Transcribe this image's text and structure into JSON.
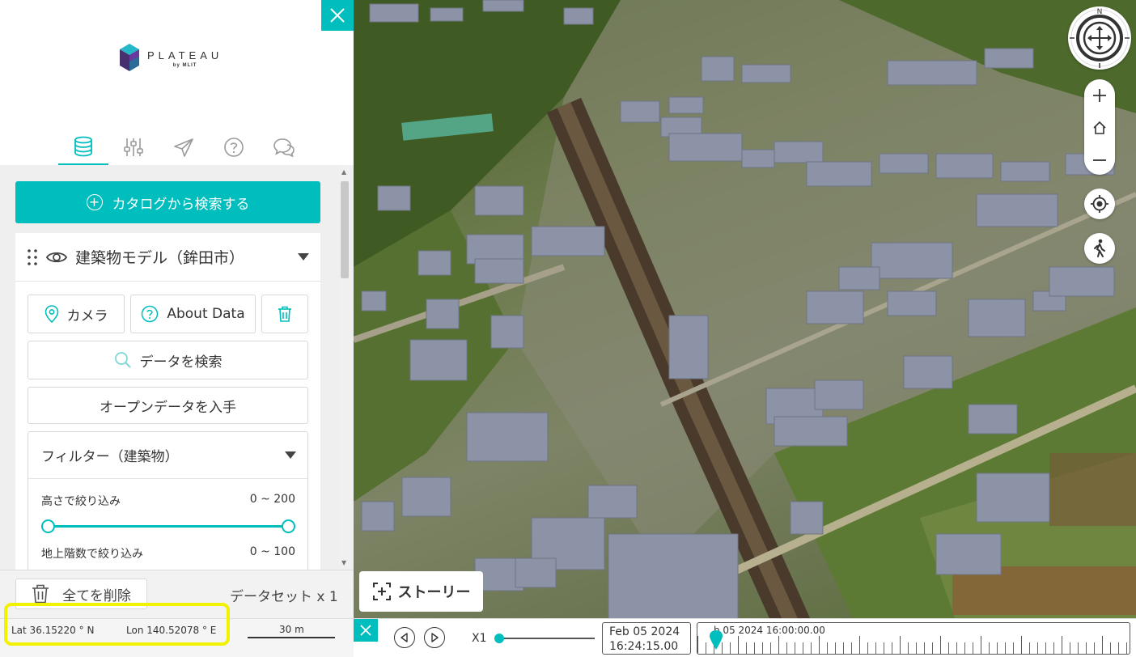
{
  "app": {
    "logo_name": "PLATEAU",
    "logo_sub": "by MLIT"
  },
  "colors": {
    "accent": "#00bebe",
    "highlight": "#f2f200"
  },
  "tabs": [
    {
      "icon": "database-icon",
      "active": true
    },
    {
      "icon": "sliders-icon",
      "active": false
    },
    {
      "icon": "paper-plane-icon",
      "active": false
    },
    {
      "icon": "help-circle-icon",
      "active": false
    },
    {
      "icon": "chat-bubbles-icon",
      "active": false
    }
  ],
  "catalog": {
    "button_label": "カタログから検索する"
  },
  "layer": {
    "title": "建築物モデル（鉾田市）",
    "camera_label": "カメラ",
    "about_label": "About Data",
    "search_data_label": "データを検索",
    "opendata_label": "オープンデータを入手"
  },
  "filter": {
    "title": "フィルター（建築物）",
    "height_label": "高さで絞り込み",
    "height_range": "0 ~ 200",
    "height_min_fraction": 0,
    "height_max_fraction": 1,
    "floor_label": "地上階数で絞り込み",
    "floor_range": "0 ~ 100"
  },
  "footer": {
    "clear_label": "全てを削除",
    "dataset_count": "データセット x 1"
  },
  "status": {
    "lat": "Lat 36.15220 ° N",
    "lon": "Lon 140.52078 ° E",
    "scale": "30 m"
  },
  "map_controls": {
    "compass_north": "N"
  },
  "story": {
    "label": "ストーリー"
  },
  "timeline": {
    "speed": "X1",
    "date": "Feb 05 2024",
    "time": "16:24:15.00",
    "track_label": "b 05 2024 16:00:00.00"
  }
}
